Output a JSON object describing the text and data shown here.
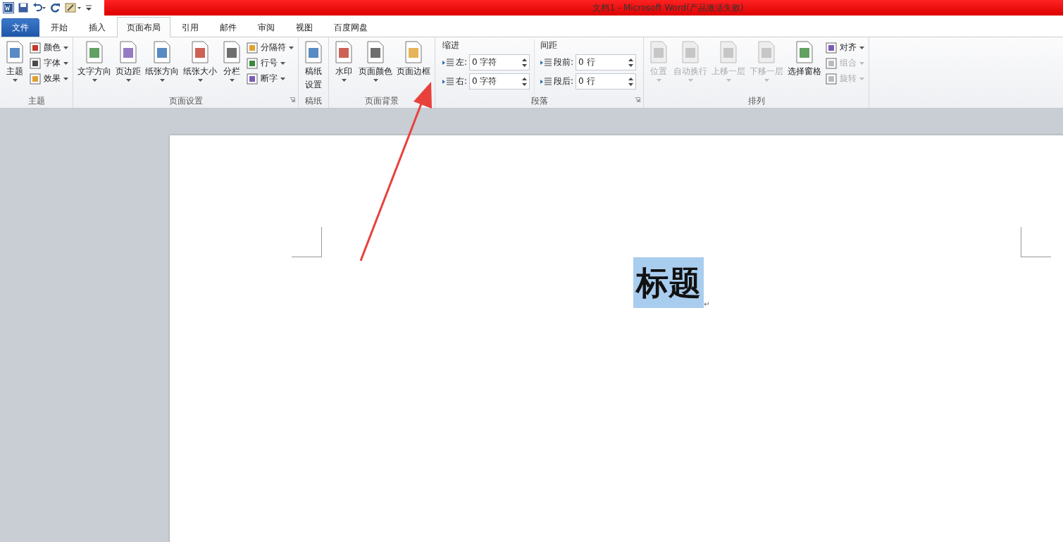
{
  "title_bar": {
    "title": "文档1 - Microsoft Word(产品激活失败)"
  },
  "tabs": [
    {
      "label": "文件",
      "kind": "file",
      "selected": false
    },
    {
      "label": "开始",
      "kind": "tab",
      "selected": false
    },
    {
      "label": "插入",
      "kind": "tab",
      "selected": false
    },
    {
      "label": "页面布局",
      "kind": "tab",
      "selected": true
    },
    {
      "label": "引用",
      "kind": "tab",
      "selected": false
    },
    {
      "label": "邮件",
      "kind": "tab",
      "selected": false
    },
    {
      "label": "审阅",
      "kind": "tab",
      "selected": false
    },
    {
      "label": "视图",
      "kind": "tab",
      "selected": false
    },
    {
      "label": "百度网盘",
      "kind": "tab",
      "selected": false
    }
  ],
  "ribbon": {
    "groups": [
      {
        "label": "主题",
        "launcher": false,
        "columns": [
          {
            "kind": "large",
            "label": "主题",
            "dropdown": true,
            "disabled": false
          },
          {
            "kind": "stack",
            "items": [
              {
                "label": "颜色",
                "dropdown": true,
                "disabled": false
              },
              {
                "label": "字体",
                "dropdown": true,
                "disabled": false
              },
              {
                "label": "效果",
                "dropdown": true,
                "disabled": false
              }
            ]
          }
        ]
      },
      {
        "label": "页面设置",
        "launcher": true,
        "columns": [
          {
            "kind": "large",
            "label": "文字方向",
            "dropdown": true,
            "disabled": false
          },
          {
            "kind": "large",
            "label": "页边距",
            "dropdown": true,
            "disabled": false
          },
          {
            "kind": "large",
            "label": "纸张方向",
            "dropdown": true,
            "disabled": false
          },
          {
            "kind": "large",
            "label": "纸张大小",
            "dropdown": true,
            "disabled": false
          },
          {
            "kind": "large",
            "label": "分栏",
            "dropdown": true,
            "disabled": false
          },
          {
            "kind": "stack",
            "items": [
              {
                "label": "分隔符",
                "dropdown": true,
                "disabled": false
              },
              {
                "label": "行号",
                "dropdown": true,
                "disabled": false
              },
              {
                "label": "断字",
                "dropdown": true,
                "disabled": false
              }
            ]
          }
        ]
      },
      {
        "label": "稿纸",
        "launcher": false,
        "columns": [
          {
            "kind": "large",
            "label": [
              "稿纸",
              "设置"
            ],
            "dropdown": false,
            "disabled": false
          }
        ]
      },
      {
        "label": "页面背景",
        "launcher": false,
        "columns": [
          {
            "kind": "large",
            "label": "水印",
            "dropdown": true,
            "disabled": false
          },
          {
            "kind": "large",
            "label": "页面颜色",
            "dropdown": true,
            "disabled": false
          },
          {
            "kind": "large",
            "label": "页面边框",
            "dropdown": false,
            "disabled": false
          }
        ]
      },
      {
        "label": "段落",
        "launcher": true,
        "columns": [
          {
            "kind": "spins",
            "title": "缩进",
            "rows": [
              {
                "label": "左:",
                "value": "0 字符"
              },
              {
                "label": "右:",
                "value": "0 字符"
              }
            ]
          },
          {
            "kind": "spins",
            "title": "间距",
            "rows": [
              {
                "label": "段前:",
                "value": "0 行"
              },
              {
                "label": "段后:",
                "value": "0 行"
              }
            ]
          }
        ]
      },
      {
        "label": "排列",
        "launcher": false,
        "columns": [
          {
            "kind": "large",
            "label": "位置",
            "dropdown": true,
            "disabled": true
          },
          {
            "kind": "large",
            "label": "自动换行",
            "dropdown": true,
            "disabled": true
          },
          {
            "kind": "large",
            "label": "上移一层",
            "dropdown": true,
            "disabled": true
          },
          {
            "kind": "large",
            "label": "下移一层",
            "dropdown": true,
            "disabled": true
          },
          {
            "kind": "large",
            "label": "选择窗格",
            "dropdown": false,
            "disabled": false
          },
          {
            "kind": "stack",
            "items": [
              {
                "label": "对齐",
                "dropdown": true,
                "disabled": false
              },
              {
                "label": "组合",
                "dropdown": true,
                "disabled": true
              },
              {
                "label": "旋转",
                "dropdown": true,
                "disabled": true
              }
            ]
          }
        ]
      }
    ]
  },
  "document": {
    "heading": "标题",
    "heading_selected": true,
    "paragraph_mark": "↵"
  }
}
